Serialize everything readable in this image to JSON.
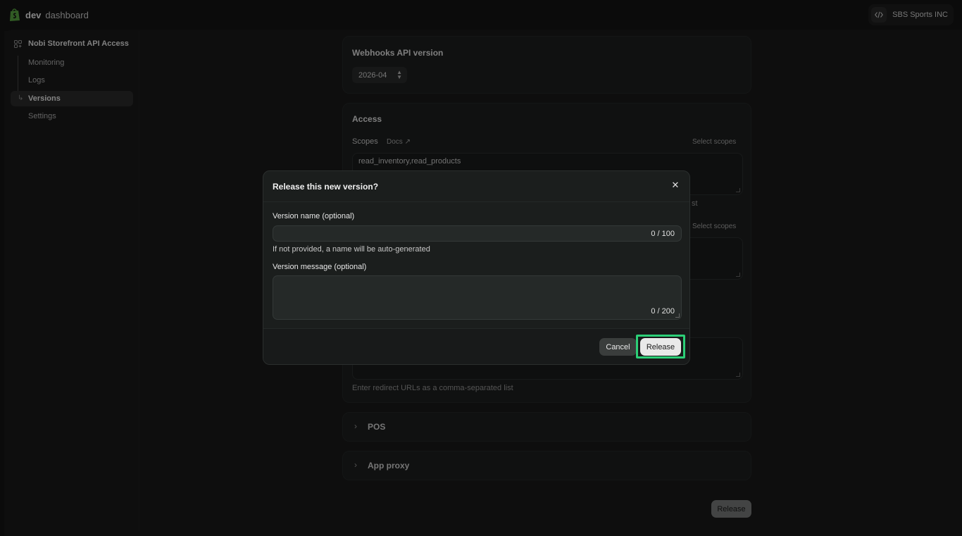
{
  "topbar": {
    "brand_bold": "dev",
    "brand_rest": "dashboard",
    "org_name": "SBS Sports INC"
  },
  "sidebar": {
    "app_name": "Nobi Storefront API Access",
    "items": [
      {
        "label": "Monitoring"
      },
      {
        "label": "Logs"
      },
      {
        "label": "Versions",
        "active": true
      },
      {
        "label": "Settings"
      }
    ]
  },
  "webhooks": {
    "title": "Webhooks API version",
    "version": "2026-04"
  },
  "access": {
    "title": "Access",
    "scopes_label": "Scopes",
    "docs_label": "Docs",
    "select_scopes": "Select scopes",
    "scopes_value": "read_inventory,read_products",
    "partial_text": "st",
    "select_scopes_2": "Select scopes",
    "redirect_help": "Enter redirect URLs as a comma-separated list"
  },
  "accordions": [
    {
      "title": "POS"
    },
    {
      "title": "App proxy"
    }
  ],
  "footer": {
    "release_label": "Release"
  },
  "modal": {
    "title": "Release this new version?",
    "close_icon": "close-icon",
    "name_label": "Version name (optional)",
    "name_value": "",
    "name_counter": "0 / 100",
    "name_help": "If not provided, a name will be auto-generated",
    "message_label": "Version message (optional)",
    "message_value": "",
    "message_counter": "0 / 200",
    "cancel_label": "Cancel",
    "release_label": "Release",
    "highlight_color": "#2ccf77"
  }
}
